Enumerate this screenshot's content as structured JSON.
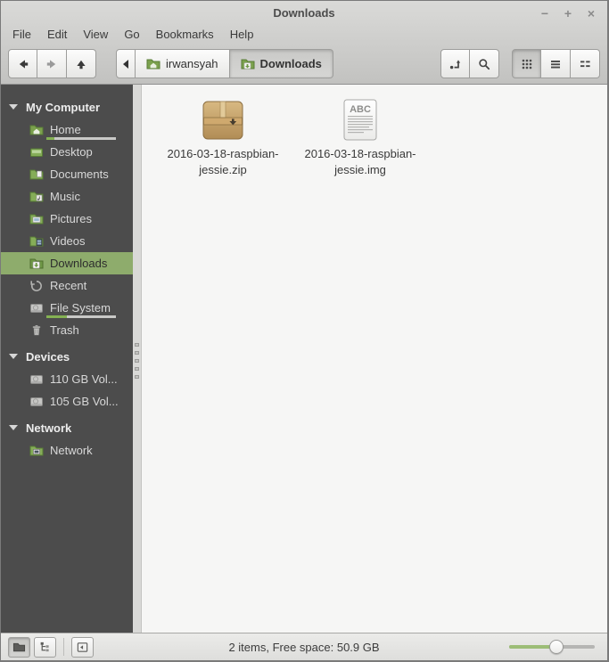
{
  "window": {
    "title": "Downloads",
    "controls": {
      "minimize": "−",
      "maximize": "+",
      "close": "×"
    }
  },
  "menubar": {
    "items": [
      "File",
      "Edit",
      "View",
      "Go",
      "Bookmarks",
      "Help"
    ]
  },
  "toolbar": {
    "breadcrumb": {
      "parent": "irwansyah",
      "current": "Downloads"
    }
  },
  "sidebar": {
    "sections": [
      {
        "label": "My Computer",
        "items": [
          {
            "label": "Home",
            "usage_percent": 11
          },
          {
            "label": "Desktop"
          },
          {
            "label": "Documents"
          },
          {
            "label": "Music"
          },
          {
            "label": "Pictures"
          },
          {
            "label": "Videos"
          },
          {
            "label": "Downloads",
            "selected": true
          },
          {
            "label": "Recent"
          },
          {
            "label": "File System",
            "usage_percent": 30
          },
          {
            "label": "Trash"
          }
        ]
      },
      {
        "label": "Devices",
        "items": [
          {
            "label": "110 GB Vol..."
          },
          {
            "label": "105 GB Vol..."
          }
        ]
      },
      {
        "label": "Network",
        "items": [
          {
            "label": "Network"
          }
        ]
      }
    ]
  },
  "files": [
    {
      "name": "2016-03-18-raspbian-jessie.zip",
      "type": "zip-archive"
    },
    {
      "name": "2016-03-18-raspbian-jessie.img",
      "type": "disk-image",
      "icon_label": "ABC"
    }
  ],
  "statusbar": {
    "text": "2 items, Free space: 50.9 GB",
    "zoom_percent": 55
  },
  "colors": {
    "selection_green": "#8eac6c",
    "folder_green": "#85ad58",
    "archive_tan": "#c8a265",
    "sidebar_bg": "#4c4c4c"
  }
}
